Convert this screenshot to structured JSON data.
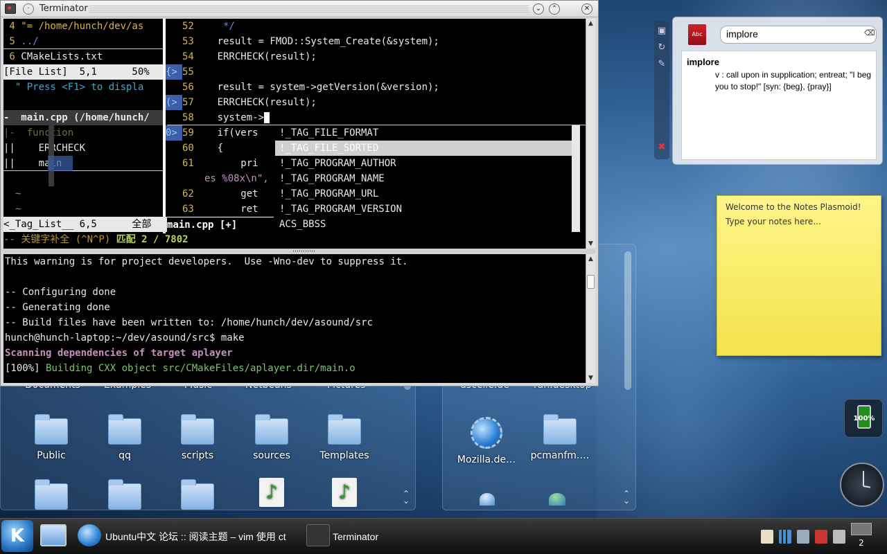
{
  "terminator": {
    "title": "Terminator",
    "vim": {
      "taglist_lines": [
        {
          "num": " 4",
          "text": " \"= /home/hunch/dev/as"
        },
        {
          "num": " 5",
          "text": " ../"
        },
        {
          "num": " 6",
          "text": " CMakeLists.txt"
        },
        {
          "status": "[File List]  5,1      50%"
        },
        {
          "text": "  \" Press <F1> to displa"
        },
        {
          "text": ""
        },
        {
          "text": "-  main.cpp (/home/hunch/"
        },
        {
          "text": "|-  function"
        },
        {
          "text": "||    ERRCHECK"
        },
        {
          "text": "||    main"
        },
        {
          "text": ""
        },
        {
          "text": "  ~"
        },
        {
          "text": "  ~"
        }
      ],
      "gutter_marks": [
        "{>",
        "(>",
        "0>"
      ],
      "code_lines": [
        {
          "num": "52",
          "text": "     */"
        },
        {
          "num": "53",
          "text": "    result = FMOD::System_Create(&system);"
        },
        {
          "num": "54",
          "text": "    ERRCHECK(result);"
        },
        {
          "num": "55",
          "text": ""
        },
        {
          "num": "56",
          "text": "    result = system->getVersion(&version);"
        },
        {
          "num": "57",
          "text": "    ERRCHECK(result);"
        },
        {
          "num": "58",
          "text": "    system->"
        },
        {
          "num": "59",
          "text": "    if(vers"
        },
        {
          "num": "60",
          "text": "    {"
        },
        {
          "num": "61",
          "text": "        pri"
        },
        {
          "num": "",
          "text": "es %08x\\n\","
        },
        {
          "num": "62",
          "text": "        get"
        },
        {
          "num": "63",
          "text": "        ret"
        }
      ],
      "completion_items": [
        "!_TAG_FILE_FORMAT",
        "!_TAG_FILE_SORTED",
        "!_TAG_PROGRAM_AUTHOR",
        "!_TAG_PROGRAM_NAME",
        "!_TAG_PROGRAM_URL",
        "!_TAG_PROGRAM_VERSION",
        "ACS_BBSS"
      ],
      "selected_completion": 1,
      "statusline_left": "<_Tag_List__ 6,5      全部",
      "statusline_right": "main.cpp [+]",
      "mode_line_prefix": "-- 关键字补全 (^N^P)",
      "mode_line_match": "匹配 2 / 7802"
    },
    "shell_lines": [
      {
        "text": "This warning is for project developers.  Use -Wno-dev to suppress it.",
        "color": "white"
      },
      {
        "text": "",
        "color": "white"
      },
      {
        "text": "-- Configuring done",
        "color": "white"
      },
      {
        "text": "-- Generating done",
        "color": "white"
      },
      {
        "text": "-- Build files have been written to: /home/hunch/dev/asound/src",
        "color": "white"
      },
      {
        "text": "hunch@hunch-laptop:~/dev/asound/src$ make",
        "color": "white"
      },
      {
        "text": "Scanning dependencies of target aplayer",
        "color": "purple"
      },
      {
        "text": "[100%] ",
        "color": "white",
        "rest": "Building CXX object src/CMakeFiles/aplayer.dir/main.o"
      }
    ]
  },
  "dictionary": {
    "query": "implore",
    "word": "implore",
    "definition": "v : call upon in supplication; entreat; \"I beg you to stop!\" [syn: {beg}, {pray}]",
    "book_label": "Abc"
  },
  "notes": {
    "line1": "Welcome to the Notes Plasmoid!",
    "line2": "Type your notes here..."
  },
  "battery": {
    "percent_label": "100%"
  },
  "folderview_left": {
    "partial_labels": [
      "Documents",
      "Examples",
      "Music",
      "Netbeans",
      "Pictures"
    ],
    "items": [
      "Public",
      "qq",
      "scripts",
      "sources",
      "Templates"
    ]
  },
  "folderview_right": {
    "partial_labels": [
      "dscelle.de",
      "ran.desktop"
    ],
    "items": [
      "Mozilla.de…",
      "pcmanfm.…"
    ]
  },
  "taskbar": {
    "kmenu_label": "K",
    "tasks": [
      {
        "label": "Ubuntu中文 论坛 :: 阅读主题 – vim 使用 ct"
      },
      {
        "label": "Terminator"
      }
    ],
    "pager_number": "2"
  },
  "colors": {
    "vim_line_number": "#d7b24b",
    "vim_text": "#e8e8e8",
    "vim_comment": "#6b8fd9",
    "taglist_cyan": "#3fa7c9",
    "make_green": "#7cc46a",
    "make_purple": "#c58fbf",
    "notes_bg": "#f3e24b"
  }
}
